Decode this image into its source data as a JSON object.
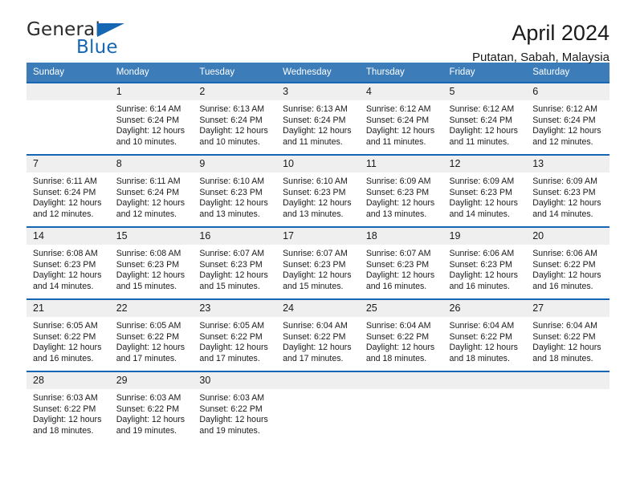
{
  "brand": {
    "name_part1": "General",
    "name_part2": "Blue",
    "triangle_color": "#1667b3"
  },
  "header": {
    "title": "April 2024",
    "subtitle": "Putatan, Sabah, Malaysia"
  },
  "theme": {
    "header_blue": "#3b7cb9",
    "row_rule_blue": "#1667b3",
    "daynum_band": "#efefef"
  },
  "weekdays": [
    "Sunday",
    "Monday",
    "Tuesday",
    "Wednesday",
    "Thursday",
    "Friday",
    "Saturday"
  ],
  "labels": {
    "sunrise_prefix": "Sunrise: ",
    "sunset_prefix": "Sunset: ",
    "daylight_prefix": "Daylight: "
  },
  "weeks": [
    [
      {
        "day": "",
        "sunrise": "",
        "sunset": "",
        "daylight": "",
        "daylight2": ""
      },
      {
        "day": "1",
        "sunrise": "Sunrise: 6:14 AM",
        "sunset": "Sunset: 6:24 PM",
        "daylight": "Daylight: 12 hours",
        "daylight2": "and 10 minutes."
      },
      {
        "day": "2",
        "sunrise": "Sunrise: 6:13 AM",
        "sunset": "Sunset: 6:24 PM",
        "daylight": "Daylight: 12 hours",
        "daylight2": "and 10 minutes."
      },
      {
        "day": "3",
        "sunrise": "Sunrise: 6:13 AM",
        "sunset": "Sunset: 6:24 PM",
        "daylight": "Daylight: 12 hours",
        "daylight2": "and 11 minutes."
      },
      {
        "day": "4",
        "sunrise": "Sunrise: 6:12 AM",
        "sunset": "Sunset: 6:24 PM",
        "daylight": "Daylight: 12 hours",
        "daylight2": "and 11 minutes."
      },
      {
        "day": "5",
        "sunrise": "Sunrise: 6:12 AM",
        "sunset": "Sunset: 6:24 PM",
        "daylight": "Daylight: 12 hours",
        "daylight2": "and 11 minutes."
      },
      {
        "day": "6",
        "sunrise": "Sunrise: 6:12 AM",
        "sunset": "Sunset: 6:24 PM",
        "daylight": "Daylight: 12 hours",
        "daylight2": "and 12 minutes."
      }
    ],
    [
      {
        "day": "7",
        "sunrise": "Sunrise: 6:11 AM",
        "sunset": "Sunset: 6:24 PM",
        "daylight": "Daylight: 12 hours",
        "daylight2": "and 12 minutes."
      },
      {
        "day": "8",
        "sunrise": "Sunrise: 6:11 AM",
        "sunset": "Sunset: 6:24 PM",
        "daylight": "Daylight: 12 hours",
        "daylight2": "and 12 minutes."
      },
      {
        "day": "9",
        "sunrise": "Sunrise: 6:10 AM",
        "sunset": "Sunset: 6:23 PM",
        "daylight": "Daylight: 12 hours",
        "daylight2": "and 13 minutes."
      },
      {
        "day": "10",
        "sunrise": "Sunrise: 6:10 AM",
        "sunset": "Sunset: 6:23 PM",
        "daylight": "Daylight: 12 hours",
        "daylight2": "and 13 minutes."
      },
      {
        "day": "11",
        "sunrise": "Sunrise: 6:09 AM",
        "sunset": "Sunset: 6:23 PM",
        "daylight": "Daylight: 12 hours",
        "daylight2": "and 13 minutes."
      },
      {
        "day": "12",
        "sunrise": "Sunrise: 6:09 AM",
        "sunset": "Sunset: 6:23 PM",
        "daylight": "Daylight: 12 hours",
        "daylight2": "and 14 minutes."
      },
      {
        "day": "13",
        "sunrise": "Sunrise: 6:09 AM",
        "sunset": "Sunset: 6:23 PM",
        "daylight": "Daylight: 12 hours",
        "daylight2": "and 14 minutes."
      }
    ],
    [
      {
        "day": "14",
        "sunrise": "Sunrise: 6:08 AM",
        "sunset": "Sunset: 6:23 PM",
        "daylight": "Daylight: 12 hours",
        "daylight2": "and 14 minutes."
      },
      {
        "day": "15",
        "sunrise": "Sunrise: 6:08 AM",
        "sunset": "Sunset: 6:23 PM",
        "daylight": "Daylight: 12 hours",
        "daylight2": "and 15 minutes."
      },
      {
        "day": "16",
        "sunrise": "Sunrise: 6:07 AM",
        "sunset": "Sunset: 6:23 PM",
        "daylight": "Daylight: 12 hours",
        "daylight2": "and 15 minutes."
      },
      {
        "day": "17",
        "sunrise": "Sunrise: 6:07 AM",
        "sunset": "Sunset: 6:23 PM",
        "daylight": "Daylight: 12 hours",
        "daylight2": "and 15 minutes."
      },
      {
        "day": "18",
        "sunrise": "Sunrise: 6:07 AM",
        "sunset": "Sunset: 6:23 PM",
        "daylight": "Daylight: 12 hours",
        "daylight2": "and 16 minutes."
      },
      {
        "day": "19",
        "sunrise": "Sunrise: 6:06 AM",
        "sunset": "Sunset: 6:23 PM",
        "daylight": "Daylight: 12 hours",
        "daylight2": "and 16 minutes."
      },
      {
        "day": "20",
        "sunrise": "Sunrise: 6:06 AM",
        "sunset": "Sunset: 6:22 PM",
        "daylight": "Daylight: 12 hours",
        "daylight2": "and 16 minutes."
      }
    ],
    [
      {
        "day": "21",
        "sunrise": "Sunrise: 6:05 AM",
        "sunset": "Sunset: 6:22 PM",
        "daylight": "Daylight: 12 hours",
        "daylight2": "and 16 minutes."
      },
      {
        "day": "22",
        "sunrise": "Sunrise: 6:05 AM",
        "sunset": "Sunset: 6:22 PM",
        "daylight": "Daylight: 12 hours",
        "daylight2": "and 17 minutes."
      },
      {
        "day": "23",
        "sunrise": "Sunrise: 6:05 AM",
        "sunset": "Sunset: 6:22 PM",
        "daylight": "Daylight: 12 hours",
        "daylight2": "and 17 minutes."
      },
      {
        "day": "24",
        "sunrise": "Sunrise: 6:04 AM",
        "sunset": "Sunset: 6:22 PM",
        "daylight": "Daylight: 12 hours",
        "daylight2": "and 17 minutes."
      },
      {
        "day": "25",
        "sunrise": "Sunrise: 6:04 AM",
        "sunset": "Sunset: 6:22 PM",
        "daylight": "Daylight: 12 hours",
        "daylight2": "and 18 minutes."
      },
      {
        "day": "26",
        "sunrise": "Sunrise: 6:04 AM",
        "sunset": "Sunset: 6:22 PM",
        "daylight": "Daylight: 12 hours",
        "daylight2": "and 18 minutes."
      },
      {
        "day": "27",
        "sunrise": "Sunrise: 6:04 AM",
        "sunset": "Sunset: 6:22 PM",
        "daylight": "Daylight: 12 hours",
        "daylight2": "and 18 minutes."
      }
    ],
    [
      {
        "day": "28",
        "sunrise": "Sunrise: 6:03 AM",
        "sunset": "Sunset: 6:22 PM",
        "daylight": "Daylight: 12 hours",
        "daylight2": "and 18 minutes."
      },
      {
        "day": "29",
        "sunrise": "Sunrise: 6:03 AM",
        "sunset": "Sunset: 6:22 PM",
        "daylight": "Daylight: 12 hours",
        "daylight2": "and 19 minutes."
      },
      {
        "day": "30",
        "sunrise": "Sunrise: 6:03 AM",
        "sunset": "Sunset: 6:22 PM",
        "daylight": "Daylight: 12 hours",
        "daylight2": "and 19 minutes."
      },
      {
        "day": "",
        "sunrise": "",
        "sunset": "",
        "daylight": "",
        "daylight2": ""
      },
      {
        "day": "",
        "sunrise": "",
        "sunset": "",
        "daylight": "",
        "daylight2": ""
      },
      {
        "day": "",
        "sunrise": "",
        "sunset": "",
        "daylight": "",
        "daylight2": ""
      },
      {
        "day": "",
        "sunrise": "",
        "sunset": "",
        "daylight": "",
        "daylight2": ""
      }
    ]
  ]
}
